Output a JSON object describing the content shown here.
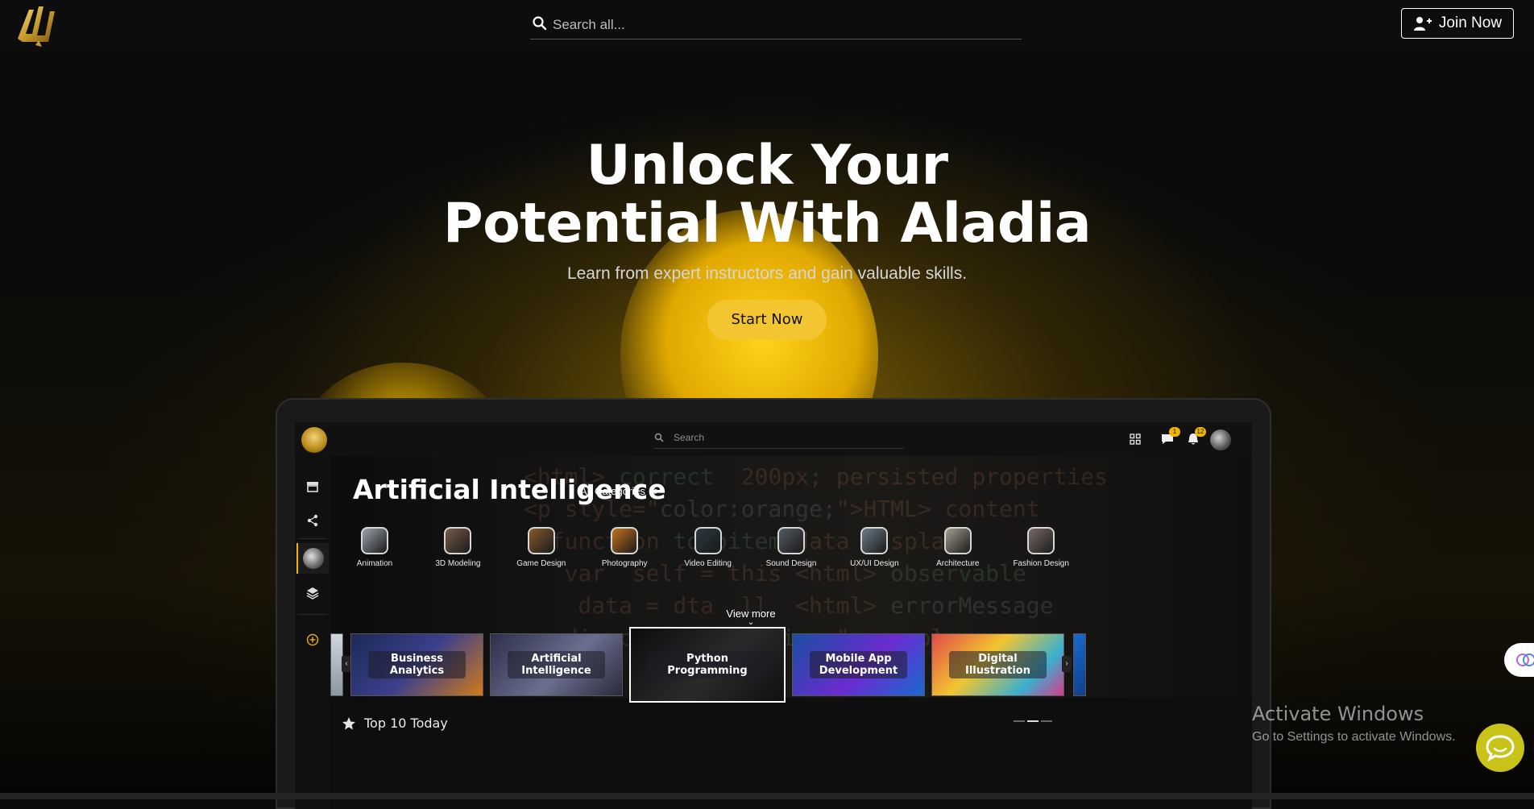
{
  "navbar": {
    "search_placeholder": "Search all...",
    "join_label": "Join Now"
  },
  "hero": {
    "title_line1": "Unlock Your",
    "title_line2": "Potential With Aladia",
    "subtitle": "Learn from expert instructors and gain valuable skills.",
    "cta_label": "Start Now"
  },
  "app_preview": {
    "search_placeholder": "Search",
    "messages_badge": "1",
    "notifications_badge": "12",
    "banner_title": "Artificial Intelligence",
    "all_categories_label": "All Categories",
    "all_categories_arrow": ">",
    "categories": [
      {
        "label": "Animation",
        "color": "#9aa3ad"
      },
      {
        "label": "3D Modeling",
        "color": "#7a5b4a"
      },
      {
        "label": "Game Design",
        "color": "#8a5a2a"
      },
      {
        "label": "Photography",
        "color": "#c4721e"
      },
      {
        "label": "Video Editing",
        "color": "#2a3a40"
      },
      {
        "label": "Sound Design",
        "color": "#545b63"
      },
      {
        "label": "UX/UI Design",
        "color": "#6b7d8a"
      },
      {
        "label": "Architecture",
        "color": "#a49c8e"
      },
      {
        "label": "Fashion Design",
        "color": "#7b6a66"
      }
    ],
    "view_more_label": "View more",
    "cards": [
      {
        "label": "Business Analytics",
        "bg": "linear-gradient(135deg,#1c2a55,#3b3f8c 50%,#d07a18)"
      },
      {
        "label": "Artificial Intelligence",
        "bg": "linear-gradient(135deg,#2d2f4a,#6b6e8e 55%,#2a2b3b)"
      },
      {
        "label": "Python Programming",
        "bg": "linear-gradient(135deg,#0d0d0d,#2a2a2a 55%,#101010)"
      },
      {
        "label": "Mobile App Development",
        "bg": "linear-gradient(135deg,#1a4fa0,#6b2bd1 55%,#1a6ad0)"
      },
      {
        "label": "Digital Illustration",
        "bg": "linear-gradient(135deg,#e24a4a,#f1c531 40%,#3ab0d0 75%,#d63a8a)"
      }
    ],
    "section_title": "Top 10 Today"
  },
  "watermark": {
    "line1": "Activate Windows",
    "line2": "Go to Settings to activate Windows."
  },
  "colors": {
    "accent": "#f2c531",
    "background": "#0b0b0b"
  }
}
